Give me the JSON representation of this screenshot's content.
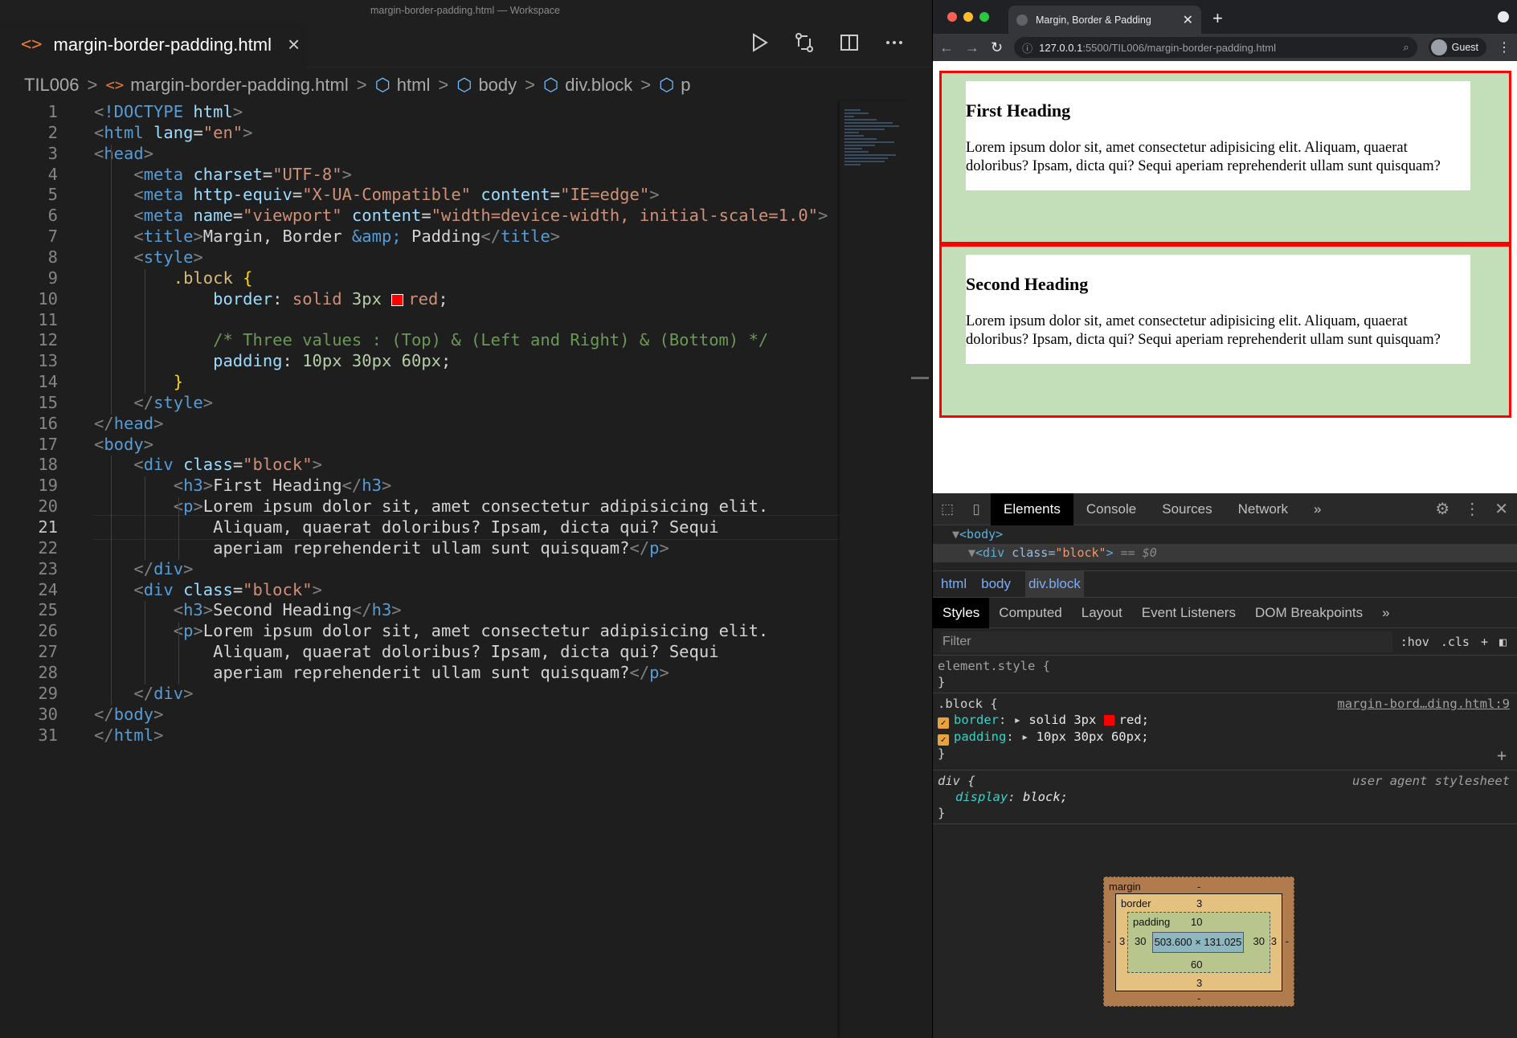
{
  "vscode": {
    "window_title": "margin-border-padding.html — Workspace",
    "tab": {
      "icon": "html-file-icon",
      "label": "margin-border-padding.html",
      "close": "×"
    },
    "breadcrumbs": [
      "TIL006",
      "margin-border-padding.html",
      "html",
      "body",
      "div.block",
      "p"
    ],
    "active_line": 21,
    "lines": [
      "<!DOCTYPE html>",
      "<html lang=\"en\">",
      "<head>",
      "    <meta charset=\"UTF-8\">",
      "    <meta http-equiv=\"X-UA-Compatible\" content=\"IE=edge\">",
      "    <meta name=\"viewport\" content=\"width=device-width, initial-scale=1.0\">",
      "    <title>Margin, Border &amp; Padding</title>",
      "    <style>",
      "        .block {",
      "            border: solid 3px red;",
      "",
      "            /* Three values : (Top) & (Left and Right) & (Bottom) */",
      "            padding: 10px 30px 60px;",
      "        }",
      "    </style>",
      "</head>",
      "<body>",
      "    <div class=\"block\">",
      "        <h3>First Heading</h3>",
      "        <p>Lorem ipsum dolor sit, amet consectetur adipisicing elit.",
      "            Aliquam, quaerat doloribus? Ipsam, dicta qui? Sequi",
      "            aperiam reprehenderit ullam sunt quisquam?</p>",
      "    </div>",
      "    <div class=\"block\">",
      "        <h3>Second Heading</h3>",
      "        <p>Lorem ipsum dolor sit, amet consectetur adipisicing elit.",
      "            Aliquam, quaerat doloribus? Ipsam, dicta qui? Sequi",
      "            aperiam reprehenderit ullam sunt quisquam?</p>",
      "    </div>",
      "</body>",
      "</html>"
    ]
  },
  "browser": {
    "tab_title": "Margin, Border & Padding",
    "url_host": "127.0.0.1",
    "url_rest": ":5500/TIL006/margin-border-padding.html",
    "profile": "Guest",
    "page": {
      "blocks": [
        {
          "heading": "First Heading",
          "text": "Lorem ipsum dolor sit, amet consectetur adipisicing elit. Aliquam, quaerat doloribus? Ipsam, dicta qui? Sequi aperiam reprehenderit ullam sunt quisquam?"
        },
        {
          "heading": "Second Heading",
          "text": "Lorem ipsum dolor sit, amet consectetur adipisicing elit. Aliquam, quaerat doloribus? Ipsam, dicta qui? Sequi aperiam reprehenderit ullam sunt quisquam?"
        }
      ],
      "colors": {
        "border": "#ff0000",
        "block_bg": "#c3dfb9",
        "content_bg": "#ffffff"
      }
    },
    "devtools": {
      "tabs": [
        "Elements",
        "Console",
        "Sources",
        "Network",
        "»"
      ],
      "active_tab": "Elements",
      "dom": {
        "body_row": "<body>",
        "div_tag": "<div",
        "div_attr": "class=",
        "div_val": "\"block\"",
        "div_end": ">",
        "div_eq": "== $0"
      },
      "crumbs": [
        "html",
        "body",
        "div.block"
      ],
      "style_tabs": [
        "Styles",
        "Computed",
        "Layout",
        "Event Listeners",
        "DOM Breakpoints",
        "»"
      ],
      "filter_placeholder": "Filter",
      "filter_tools": [
        ":hov",
        ".cls",
        "+"
      ],
      "rules": {
        "element_style": "element.style {",
        "close": "}",
        "block_selector": ".block {",
        "block_source": "margin-bord…ding.html:9",
        "border_prop": "border",
        "border_val": "solid 3px red;",
        "padding_prop": "padding",
        "padding_val": "10px 30px 60px;",
        "div_selector": "div {",
        "div_source": "user agent stylesheet",
        "display_prop": "display",
        "display_val": "block;"
      },
      "box_model": {
        "margin_label": "margin",
        "margin_value": "-",
        "border_label": "border",
        "border_value": "3",
        "padding_label": "padding",
        "padding_top": "10",
        "padding_lr": "30",
        "padding_bottom": "60",
        "content": "503.600 × 131.025"
      }
    }
  }
}
